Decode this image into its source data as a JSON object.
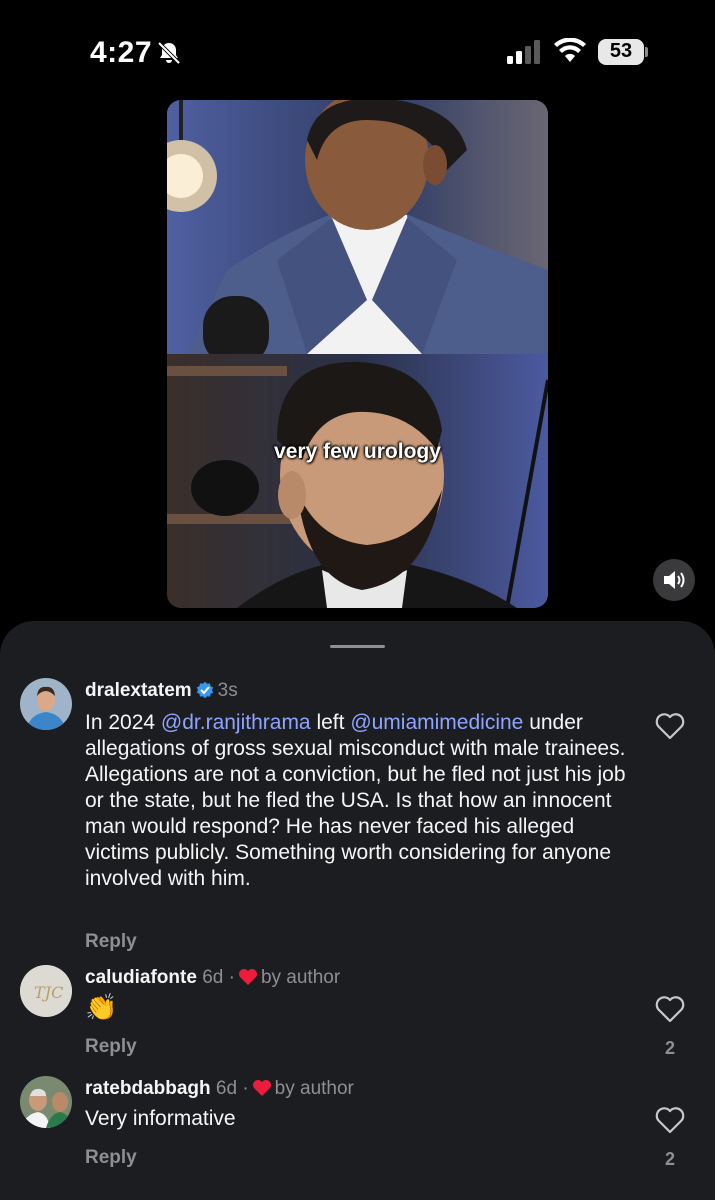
{
  "status": {
    "time": "4:27",
    "battery": "53"
  },
  "video": {
    "caption": "very few urology"
  },
  "comments": [
    {
      "username": "dralextatem",
      "time": "3s",
      "verified": true,
      "text_parts": [
        "In 2024 ",
        "@dr.ranjithrama",
        " left ",
        "@umiamimedicine",
        " under allegations of gross sexual misconduct with male trainees. Allegations are not a conviction, but he fled not just his job or the state, but he fled the USA. Is that how an innocent man would respond? He has never faced his alleged victims publicly. Something worth considering for anyone involved with him."
      ],
      "reply": "Reply"
    },
    {
      "username": "caludiafonte",
      "time": "6d",
      "separator": "·",
      "by_author": "by author",
      "text": "👏",
      "reply": "Reply",
      "likes": "2"
    },
    {
      "username": "ratebdabbagh",
      "time": "6d",
      "separator": "·",
      "by_author": "by author",
      "text": "Very informative",
      "reply": "Reply",
      "likes": "2"
    }
  ],
  "colors": {
    "mention": "#8fa4ff",
    "verified": "#3897f0",
    "heart": "#ed1c3c",
    "sheet": "#1c1d20"
  },
  "icons": [
    "bell-slash-icon",
    "signal-icon",
    "wifi-icon",
    "battery-icon",
    "speaker-icon",
    "heart-outline-icon",
    "heart-filled-icon",
    "verified-badge-icon"
  ]
}
